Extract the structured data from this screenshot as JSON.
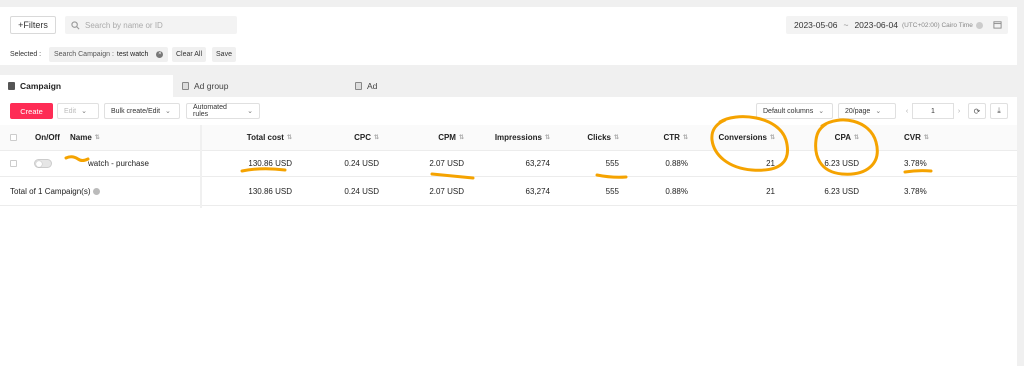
{
  "header": {
    "filters_label": "+Filters",
    "search_placeholder": "Search by name or ID",
    "date_start": "2023-05-06",
    "date_sep": "~",
    "date_end": "2023-06-04",
    "timezone": "(UTC+02:00) Cairo Time",
    "selected_label": "Selected :",
    "chip_key": "Search Campaign :",
    "chip_value": "test watch",
    "clear_all": "Clear All",
    "save": "Save"
  },
  "tabs": [
    {
      "label": "Campaign",
      "active": true
    },
    {
      "label": "Ad group",
      "active": false
    },
    {
      "label": "Ad",
      "active": false
    }
  ],
  "toolbar": {
    "create": "Create",
    "edit": "Edit",
    "bulk": "Bulk create/Edit",
    "rules": "Automated rules",
    "columns": "Default columns",
    "page_size": "20/page",
    "page": "1",
    "prev": "‹",
    "next": "›"
  },
  "table": {
    "columns": [
      "On/Off",
      "Name",
      "Total cost",
      "CPC",
      "CPM",
      "Impressions",
      "Clicks",
      "CTR",
      "Conversions",
      "CPA",
      "CVR"
    ],
    "row": {
      "name": "watch - purchase",
      "total_cost": "130.86 USD",
      "cpc": "0.24 USD",
      "cpm": "2.07 USD",
      "impressions": "63,274",
      "clicks": "555",
      "ctr": "0.88%",
      "conversions": "21",
      "cpa": "6.23 USD",
      "cvr": "3.78%"
    },
    "total": {
      "label": "Total of 1 Campaign(s)",
      "total_cost": "130.86 USD",
      "cpc": "0.24 USD",
      "cpm": "2.07 USD",
      "impressions": "63,274",
      "clicks": "555",
      "ctr": "0.88%",
      "conversions": "21",
      "cpa": "6.23 USD",
      "cvr": "3.78%"
    }
  },
  "colors": {
    "accent": "#fe2c55",
    "annotation": "#f5a300"
  },
  "icons": [
    "search-icon",
    "calendar-icon",
    "refresh-icon",
    "export-icon",
    "campaign-icon",
    "ad-group-icon",
    "ad-icon"
  ]
}
